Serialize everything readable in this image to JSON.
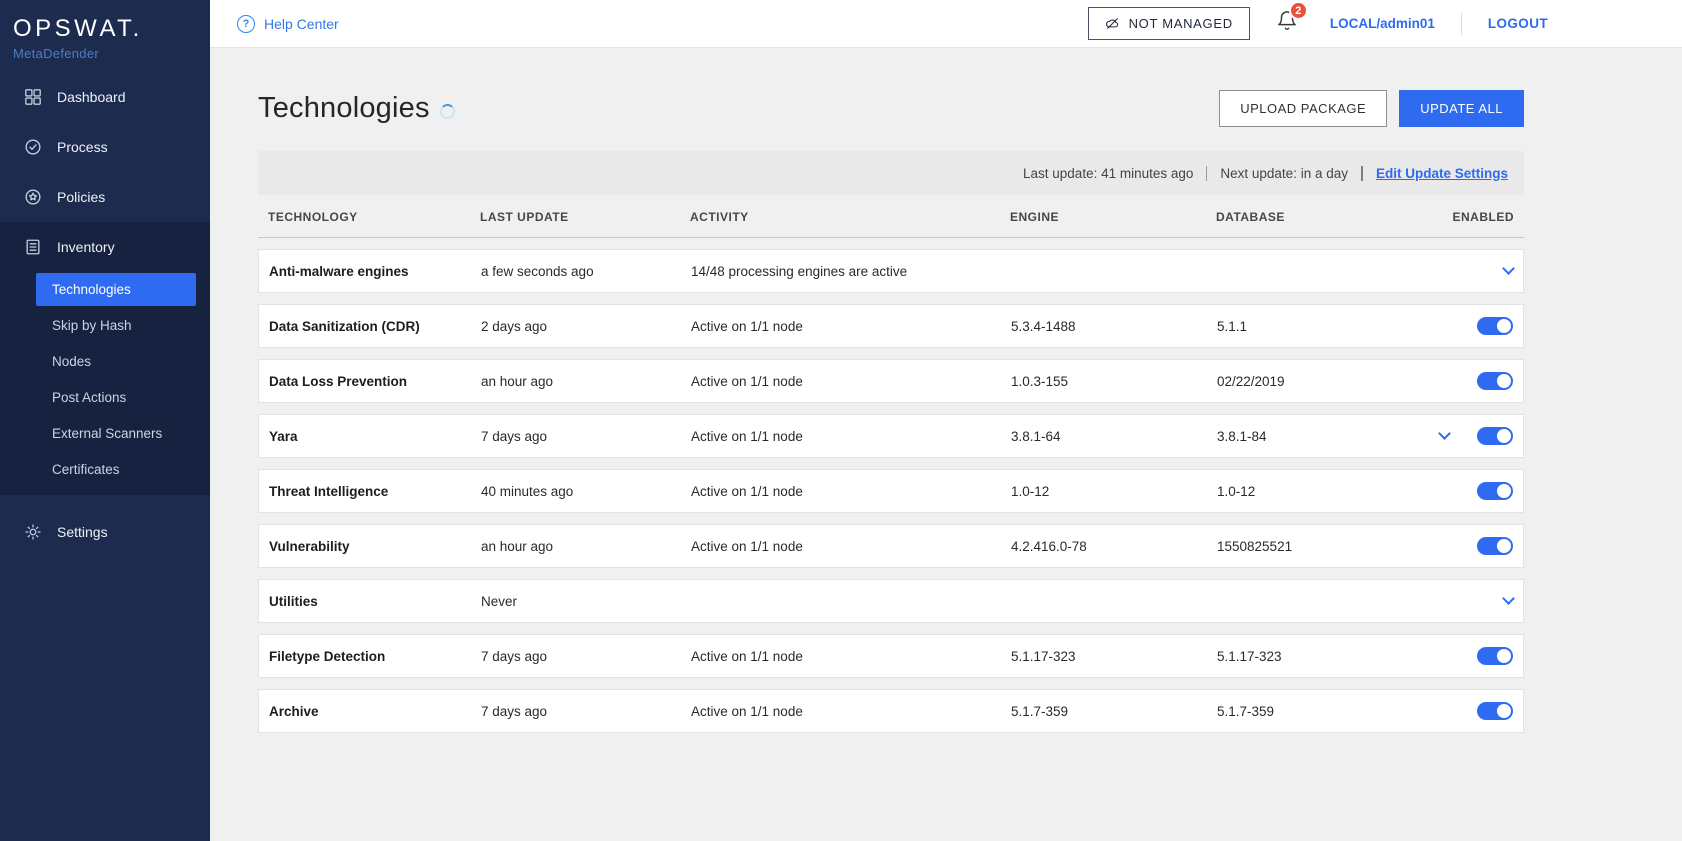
{
  "colors": {
    "accent": "#2e6bf0",
    "sidebar_bg": "#1d2b4f",
    "sidebar_section_bg": "#16223f",
    "badge": "#e8513d",
    "main_bg": "#f0f0f0",
    "statusbar_bg": "#e9e9e9"
  },
  "sidebar": {
    "logo": "OPSWAT.",
    "product": "MetaDefender",
    "items": [
      {
        "label": "Dashboard"
      },
      {
        "label": "Process"
      },
      {
        "label": "Policies"
      },
      {
        "label": "Inventory"
      },
      {
        "label": "Settings"
      }
    ],
    "inventory_children": [
      "Technologies",
      "Skip by Hash",
      "Nodes",
      "Post Actions",
      "External Scanners",
      "Certificates"
    ],
    "selected_child": "Technologies"
  },
  "topbar": {
    "help_label": "Help Center",
    "help_icon": "?",
    "not_managed_label": "NOT MANAGED",
    "notification_count": "2",
    "user_label": "LOCAL/admin01",
    "logout_label": "LOGOUT"
  },
  "main": {
    "title": "Technologies",
    "upload_package_label": "UPLOAD PACKAGE",
    "update_all_label": "UPDATE ALL",
    "status_bar": {
      "last_update": "Last update: 41 minutes ago",
      "next_update": "Next update: in a day",
      "edit_link": "Edit Update Settings"
    },
    "table": {
      "headers": [
        "TECHNOLOGY",
        "LAST UPDATE",
        "ACTIVITY",
        "ENGINE",
        "DATABASE",
        "ENABLED"
      ],
      "rows": [
        {
          "technology": "Anti-malware engines",
          "last_update": "a few seconds ago",
          "activity": "14/48 processing engines are active",
          "engine": "",
          "database": "",
          "expandable": true,
          "enabled_toggle": false,
          "enabled": null
        },
        {
          "technology": "Data Sanitization (CDR)",
          "last_update": "2 days ago",
          "activity": "Active on 1/1 node",
          "engine": "5.3.4-1488",
          "database": "5.1.1",
          "expandable": false,
          "enabled_toggle": true,
          "enabled": true
        },
        {
          "technology": "Data Loss Prevention",
          "last_update": "an hour ago",
          "activity": "Active on 1/1 node",
          "engine": "1.0.3-155",
          "database": "02/22/2019",
          "expandable": false,
          "enabled_toggle": true,
          "enabled": true
        },
        {
          "technology": "Yara",
          "last_update": "7 days ago",
          "activity": "Active on 1/1 node",
          "engine": "3.8.1-64",
          "database": "3.8.1-84",
          "expandable": true,
          "enabled_toggle": true,
          "enabled": true
        },
        {
          "technology": "Threat Intelligence",
          "last_update": "40 minutes ago",
          "activity": "Active on 1/1 node",
          "engine": "1.0-12",
          "database": "1.0-12",
          "expandable": false,
          "enabled_toggle": true,
          "enabled": true
        },
        {
          "technology": "Vulnerability",
          "last_update": "an hour ago",
          "activity": "Active on 1/1 node",
          "engine": "4.2.416.0-78",
          "database": "1550825521",
          "expandable": false,
          "enabled_toggle": true,
          "enabled": true
        },
        {
          "technology": "Utilities",
          "last_update": "Never",
          "activity": "",
          "engine": "",
          "database": "",
          "expandable": true,
          "enabled_toggle": false,
          "enabled": null
        },
        {
          "technology": "Filetype Detection",
          "last_update": "7 days ago",
          "activity": "Active on 1/1 node",
          "engine": "5.1.17-323",
          "database": "5.1.17-323",
          "expandable": false,
          "enabled_toggle": true,
          "enabled": true
        },
        {
          "technology": "Archive",
          "last_update": "7 days ago",
          "activity": "Active on 1/1 node",
          "engine": "5.1.7-359",
          "database": "5.1.7-359",
          "expandable": false,
          "enabled_toggle": true,
          "enabled": true
        }
      ]
    }
  }
}
